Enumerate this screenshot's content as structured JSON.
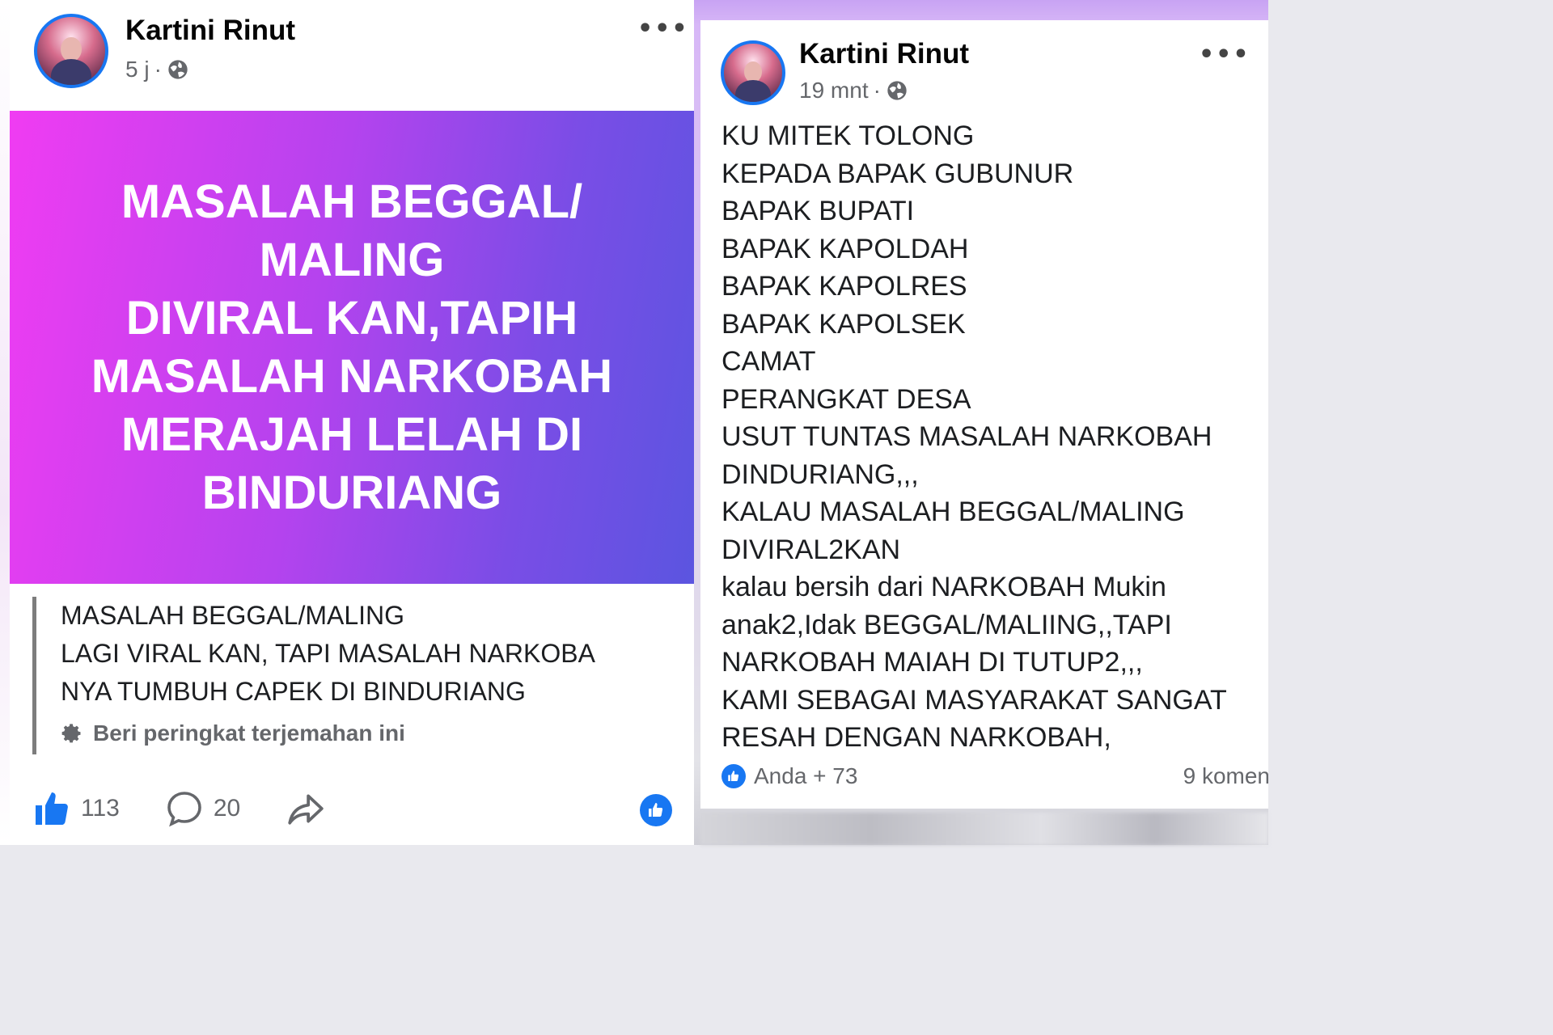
{
  "left_post": {
    "author": "Kartini Rinut",
    "time": "5 j",
    "separator": "·",
    "banner_text": "MASALAH BEGGAL/\nMALING\nDIVIRAL KAN,TAPIH\nMASALAH NARKOBAH\nMERAJAH LELAH  DI\nBINDURIANG",
    "translation": "MASALAH BEGGAL/MALING\nLAGI VIRAL KAN, TAPI MASALAH NARKOBA\nNYA TUMBUH CAPEK DI BINDURIANG",
    "rate_translation": "Beri peringkat terjemahan ini",
    "likes": "113",
    "comments": "20",
    "colors": {
      "banner_start": "#f03cf2",
      "banner_end": "#5b55e0",
      "accent": "#1877f2"
    }
  },
  "right_post": {
    "author": "Kartini Rinut",
    "time": "19 mnt",
    "separator": "·",
    "body": "KU MITEK TOLONG\nKEPADA BAPAK GUBUNUR\nBAPAK BUPATI\nBAPAK KAPOLDAH\nBAPAK KAPOLRES\nBAPAK KAPOLSEK\nCAMAT\nPERANGKAT DESA\nUSUT TUNTAS MASALAH NARKOBAH\nDINDURIANG,,,\nKALAU MASALAH BEGGAL/MALING\nDIVIRAL2KAN\nkalau bersih dari NARKOBAH Mukin\nanak2,Idak BEGGAL/MALIING,,TAPI\nNARKOBAH MAIAH DI TUTUP2,,,\nKAMI SEBAGAI MASYARAKAT SANGAT\nRESAH DENGAN NARKOBAH,",
    "reactions": "Anda + 73",
    "comments": "9 komen"
  },
  "icons": [
    "globe-icon",
    "more-icon",
    "like-icon",
    "comment-icon",
    "share-icon",
    "gear-icon",
    "like-reaction-icon"
  ]
}
